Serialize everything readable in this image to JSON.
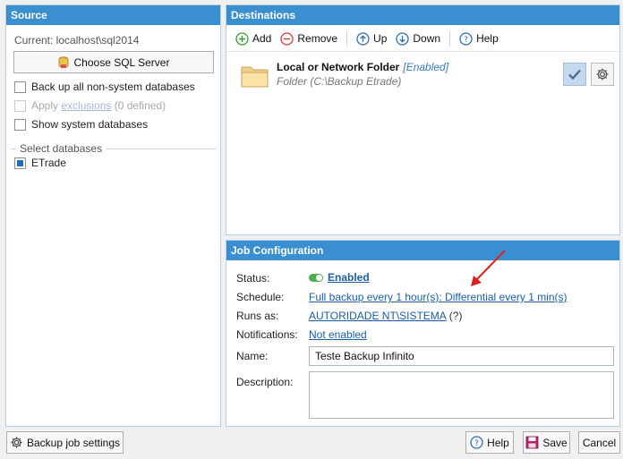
{
  "source": {
    "header": "Source",
    "current": "Current: localhost\\sql2014",
    "choose_button": "Choose SQL Server",
    "backup_all": "Back up all non-system databases",
    "apply_prefix": "Apply",
    "apply_link": "exclusions",
    "apply_suffix": "(0 defined)",
    "show_system": "Show system databases",
    "select_group": "Select databases",
    "databases": [
      {
        "name": "ETrade",
        "checked": true
      }
    ]
  },
  "destinations": {
    "header": "Destinations",
    "toolbar": {
      "add": "Add",
      "remove": "Remove",
      "up": "Up",
      "down": "Down",
      "help": "Help"
    },
    "items": [
      {
        "title": "Local or Network Folder",
        "status": "[Enabled]",
        "subtitle": "Folder (C:\\Backup Etrade)"
      }
    ]
  },
  "job_config": {
    "header": "Job Configuration",
    "labels": {
      "status": "Status:",
      "schedule": "Schedule:",
      "runs_as": "Runs as:",
      "notifications": "Notifications:",
      "name": "Name:",
      "description": "Description:"
    },
    "status_value": "Enabled",
    "schedule_value": "Full backup every 1 hour(s): Differential every 1 min(s)",
    "runs_as_value": "AUTORIDADE NT\\SISTEMA",
    "runs_as_hint": "(?)",
    "notifications_value": "Not enabled",
    "name_value": "Teste Backup Infinito",
    "description_value": ""
  },
  "bottom": {
    "settings": "Backup job settings",
    "help": "Help",
    "save": "Save",
    "cancel": "Cancel"
  },
  "colors": {
    "header_blue": "#3a8fd1",
    "link_blue": "#1a5fa8",
    "annotation_arrow": "#e02020",
    "toggle_green": "#4caf50"
  }
}
